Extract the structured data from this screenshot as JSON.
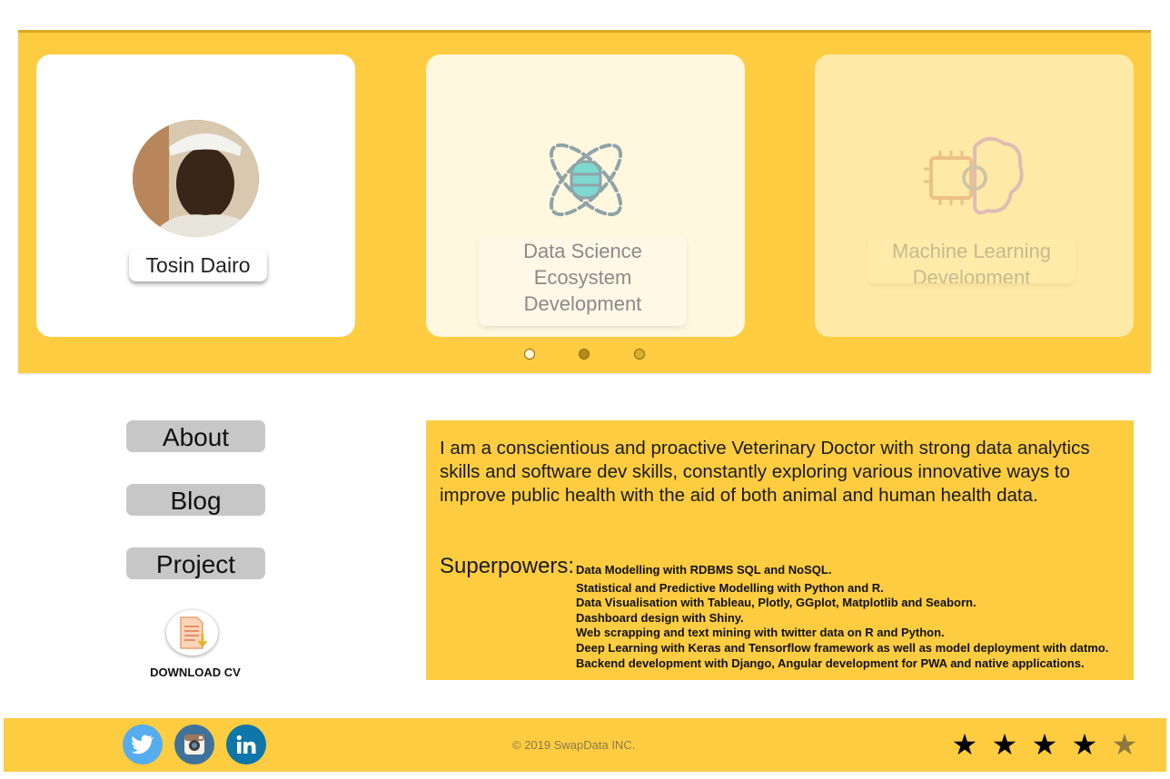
{
  "profile": {
    "name": "Tosin Dairo"
  },
  "carousel": {
    "cards": [
      {
        "label": "Data Science Ecosystem Development",
        "icon": "data-science-icon"
      },
      {
        "label": "Machine Learning Development",
        "icon": "machine-learning-icon"
      }
    ],
    "dots": 3,
    "active_dot": 2
  },
  "nav": {
    "about": "About",
    "blog": "Blog",
    "project": "Project"
  },
  "cv": {
    "label": "DOWNLOAD CV",
    "icon": "document-download-icon"
  },
  "bio": {
    "text": "I am a conscientious and proactive Veterinary Doctor with strong data analytics skills and software dev skills, constantly exploring various innovative ways to improve public health with the aid of both animal and human health data.",
    "superpowers_label": "Superpowers:",
    "superpowers": [
      "Data Modelling with RDBMS SQL and NoSQL.",
      "Statistical and Predictive Modelling with Python and R.",
      "Data Visualisation with Tableau, Plotly, GGplot, Matplotlib and Seaborn.",
      "Dashboard design with Shiny.",
      "Web scrapping and text mining with twitter data on R and Python.",
      "Deep Learning with Keras and Tensorflow framework as well as model deployment with datmo.",
      "Backend development with Django, Angular development for PWA and native applications."
    ]
  },
  "footer": {
    "copyright": "© 2019 SwapData INC.",
    "social": [
      "twitter-icon",
      "instagram-icon",
      "linkedin-icon"
    ],
    "rating": {
      "filled": 4,
      "total": 5
    },
    "star_glyph": "★"
  },
  "colors": {
    "accent": "#fdcc41",
    "nav_button": "#c7c7c7",
    "twitter": "#55acee",
    "instagram": "#3f729b",
    "linkedin": "#0e76a8"
  }
}
